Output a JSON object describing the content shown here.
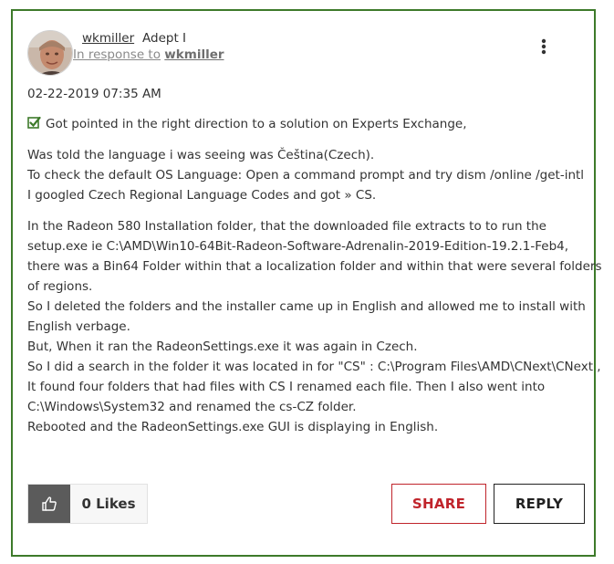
{
  "author": {
    "username": "wkmiller",
    "rank": "Adept I",
    "in_response_prefix": "In response to",
    "in_response_to": "wkmiller"
  },
  "timestamp": "02-22-2019 07:35 AM",
  "body": {
    "solution_line": "Got pointed in the right direction to a solution on Experts Exchange,",
    "paragraph_2": [
      "Was told the language i was seeing was Čeština(Czech).",
      "To check the default OS Language: Open a command prompt and try dism /online /get-intl",
      "I googled Czech Regional Language Codes and got » CS."
    ],
    "paragraph_3": [
      "In the Radeon 580 Installation folder, that the downloaded file extracts to to run the",
      "setup.exe ie C:\\AMD\\Win10-64Bit-Radeon-Software-Adrenalin-2019-Edition-19.2.1-Feb4,",
      "there was a Bin64 Folder within that a localization folder and within that were several folders",
      "of regions.",
      "So I deleted the folders and the installer came up in English and allowed me to install with",
      "English verbage.",
      "But, When it ran the RadeonSettings.exe it was again in Czech.",
      "So I did a search in the folder it was located in for \"CS\" : C:\\Program Files\\AMD\\CNext\\CNext ,",
      "It found four folders that had files with CS I renamed each file. Then I also went into",
      "C:\\Windows\\System32 and renamed the cs-CZ folder.",
      "Rebooted and the RadeonSettings.exe GUI is displaying in English."
    ]
  },
  "actions": {
    "likes_label": "0 Likes",
    "share_label": "SHARE",
    "reply_label": "REPLY"
  },
  "icons": {
    "avatar": "avatar",
    "menu": "more-vertical-icon",
    "check": "checkbox-checked-icon",
    "thumb": "thumbs-up-icon"
  },
  "colors": {
    "border_accent": "#3d7a2a",
    "check_green": "#3d7a2a",
    "share_red": "#c0242b",
    "like_button_bg": "#5b5b5b"
  }
}
